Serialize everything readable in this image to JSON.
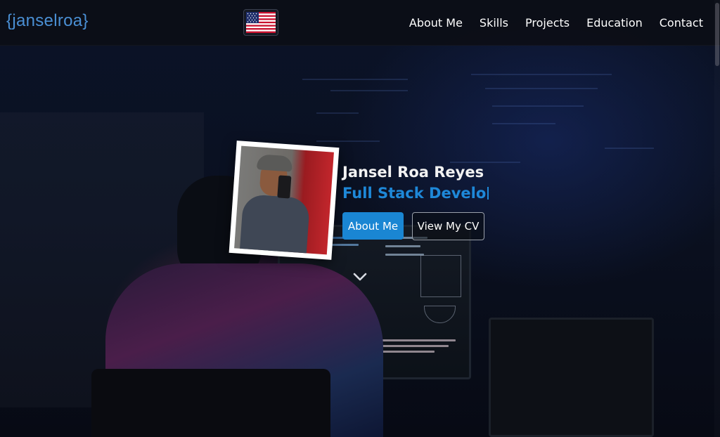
{
  "brand": {
    "logo_text": "{janselroa}"
  },
  "language": {
    "selected": "English",
    "flag_icon": "us-flag-icon"
  },
  "nav": {
    "items": [
      {
        "label": "About Me"
      },
      {
        "label": "Skills"
      },
      {
        "label": "Projects"
      },
      {
        "label": "Education"
      },
      {
        "label": "Contact"
      }
    ]
  },
  "hero": {
    "name": "Jansel Roa Reyes",
    "role_typed": "Full Stack Develo",
    "primary_button": "About Me",
    "secondary_button": "View My CV",
    "scroll_icon": "chevron-down-icon"
  },
  "colors": {
    "brand": "#4a8fd4",
    "accent": "#1a86d3",
    "role_text": "#1e88d8",
    "nav_background": "#0c0e16"
  }
}
